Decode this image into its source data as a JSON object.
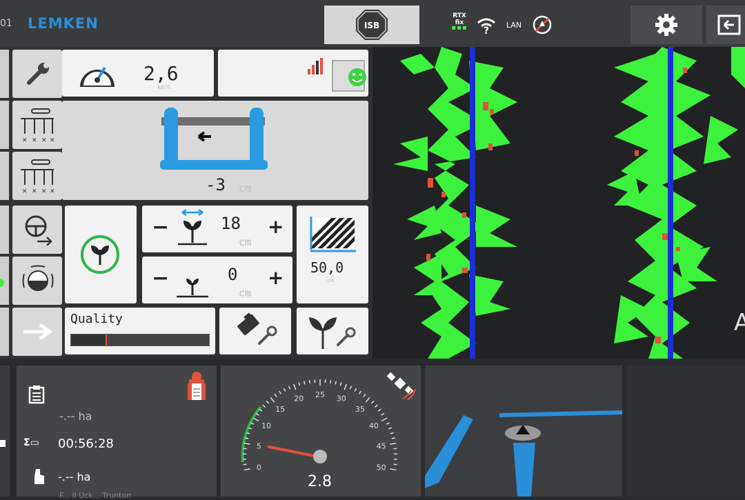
{
  "topbar": {
    "page_number_fragment": "01",
    "brand": "LEMKEN",
    "isb_label": "ISB",
    "rtx_line1": "RTX",
    "rtx_line2": "fix",
    "lan_label": "LAN"
  },
  "speed": {
    "value": "2,6",
    "unit": "km/h"
  },
  "shift": {
    "value": "-3",
    "unit": "cm"
  },
  "row_width": {
    "value": "18",
    "unit": "cm"
  },
  "plant_offset": {
    "value": "0",
    "unit": "cm"
  },
  "working_width": {
    "value": "50,0",
    "unit": "cm"
  },
  "quality": {
    "label": "Quality",
    "fraction": 0.25
  },
  "stats": {
    "area1": "-.-- ha",
    "time": "00:56:28",
    "area2": "-.-- ha",
    "truncated_footer": "F... ll Uck... Trunton"
  },
  "gauge": {
    "value": "2.8",
    "ticks": [
      "0",
      "5",
      "10",
      "15",
      "20",
      "25",
      "30",
      "35",
      "40",
      "45",
      "50"
    ]
  },
  "right_edge_letter": "A",
  "colors": {
    "plant_green": "#3df23d",
    "guide_blue": "#1a2fd6",
    "accent_blue": "#2a8fd8",
    "weed_red": "#e0523a"
  }
}
